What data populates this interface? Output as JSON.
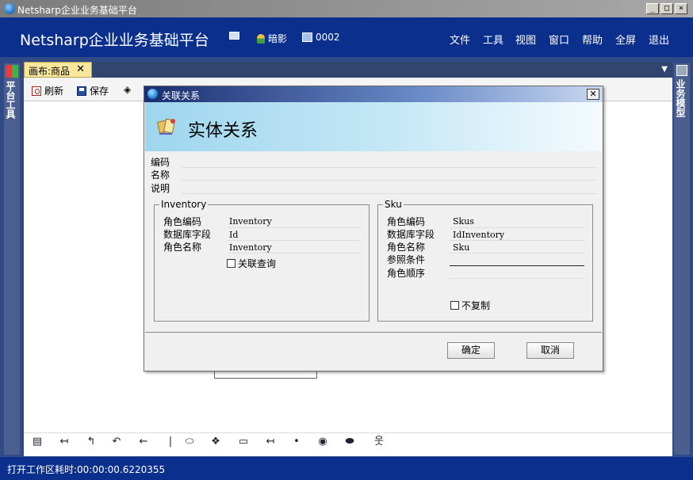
{
  "window": {
    "title": "Netsharp企业业务基础平台"
  },
  "header": {
    "app_title": "Netsharp企业业务基础平台",
    "user": "暗影",
    "code": "0002",
    "menu": [
      "文件",
      "工具",
      "视图",
      "窗口",
      "帮助",
      "全屏",
      "退出"
    ]
  },
  "side": {
    "left_label": "平台工具",
    "right_label": "业务模型"
  },
  "tab": {
    "label": "画布:商品"
  },
  "toolbar": {
    "refresh": "刷新",
    "save": "保存"
  },
  "dialog": {
    "title": "关联关系",
    "banner_title": "实体关系",
    "fields": {
      "code": "编码",
      "name": "名称",
      "desc": "说明"
    },
    "left": {
      "legend": "Inventory",
      "role_code_label": "角色编码",
      "role_code": "Inventory",
      "db_field_label": "数据库字段",
      "db_field": "Id",
      "role_name_label": "角色名称",
      "role_name": "Inventory",
      "query_label": "关联查询"
    },
    "right": {
      "legend": "Sku",
      "role_code_label": "角色编码",
      "role_code": "Skus",
      "db_field_label": "数据库字段",
      "db_field": "IdInventory",
      "role_name_label": "角色名称",
      "role_name": "Sku",
      "ref_cond_label": "参照条件",
      "role_order_label": "角色顺序",
      "nocopy_label": "不复制"
    },
    "ok": "确定",
    "cancel": "取消"
  },
  "status": {
    "text": "打开工作区耗时:00:00:00.6220355"
  }
}
